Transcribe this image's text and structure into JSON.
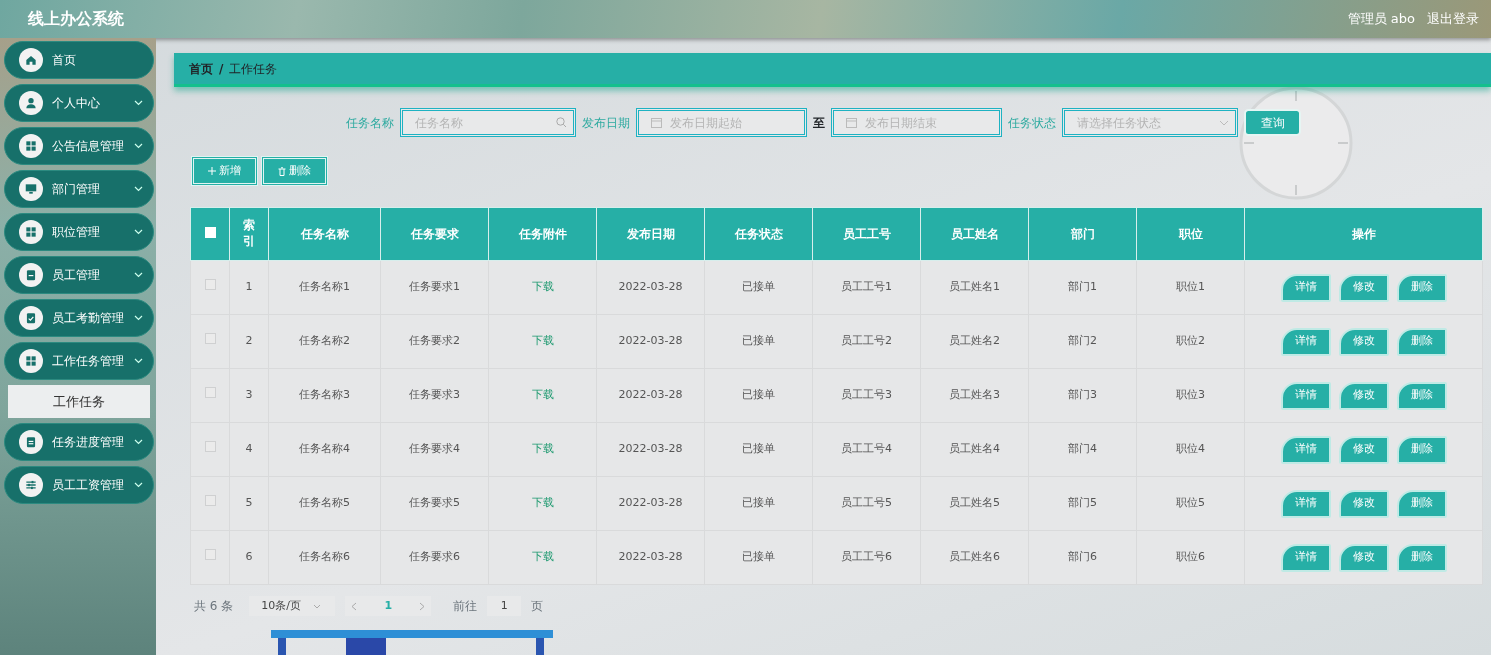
{
  "header": {
    "title": "线上办公系统",
    "role": "管理员",
    "username": "abo",
    "logout": "退出登录"
  },
  "sidebar": {
    "items": [
      {
        "label": "首页",
        "has_chevron": false
      },
      {
        "label": "个人中心",
        "has_chevron": true
      },
      {
        "label": "公告信息管理",
        "has_chevron": true
      },
      {
        "label": "部门管理",
        "has_chevron": true
      },
      {
        "label": "职位管理",
        "has_chevron": true
      },
      {
        "label": "员工管理",
        "has_chevron": true
      },
      {
        "label": "员工考勤管理",
        "has_chevron": true
      },
      {
        "label": "工作任务管理",
        "has_chevron": true,
        "children": [
          {
            "label": "工作任务",
            "selected": true
          }
        ]
      },
      {
        "label": "任务进度管理",
        "has_chevron": true
      },
      {
        "label": "员工工资管理",
        "has_chevron": true
      }
    ]
  },
  "breadcrumb": {
    "items": [
      "首页",
      "工作任务"
    ],
    "separator": "/"
  },
  "search": {
    "fields": [
      {
        "kind": "text",
        "label": "任务名称",
        "placeholder": "任务名称"
      },
      {
        "kind": "daterange",
        "label": "发布日期",
        "placeholder": "发布日期起始",
        "separator": "至",
        "placeholder_end": "发布日期结束"
      },
      {
        "kind": "select",
        "label": "任务状态",
        "placeholder": "请选择任务状态"
      }
    ],
    "button": "查询"
  },
  "actions": [
    {
      "kind": "add",
      "label": "新增"
    },
    {
      "kind": "delete",
      "label": "删除"
    }
  ],
  "table": {
    "select_all_checked": false,
    "columns": [
      "索引",
      "任务名称",
      "任务要求",
      "任务附件",
      "发布日期",
      "任务状态",
      "员工工号",
      "员工姓名",
      "部门",
      "职位",
      "操作"
    ],
    "rows": [
      {
        "checked": false,
        "cells": [
          "1",
          "任务名称1",
          "任务要求1",
          "下载",
          "2022-03-28",
          "已接单",
          "员工工号1",
          "员工姓名1",
          "部门1",
          "职位1"
        ],
        "buttons": [
          "详情",
          "修改",
          "删除"
        ]
      },
      {
        "checked": false,
        "cells": [
          "2",
          "任务名称2",
          "任务要求2",
          "下载",
          "2022-03-28",
          "已接单",
          "员工工号2",
          "员工姓名2",
          "部门2",
          "职位2"
        ],
        "buttons": [
          "详情",
          "修改",
          "删除"
        ]
      },
      {
        "checked": false,
        "cells": [
          "3",
          "任务名称3",
          "任务要求3",
          "下载",
          "2022-03-28",
          "已接单",
          "员工工号3",
          "员工姓名3",
          "部门3",
          "职位3"
        ],
        "buttons": [
          "详情",
          "修改",
          "删除"
        ]
      },
      {
        "checked": false,
        "cells": [
          "4",
          "任务名称4",
          "任务要求4",
          "下载",
          "2022-03-28",
          "已接单",
          "员工工号4",
          "员工姓名4",
          "部门4",
          "职位4"
        ],
        "buttons": [
          "详情",
          "修改",
          "删除"
        ]
      },
      {
        "checked": false,
        "cells": [
          "5",
          "任务名称5",
          "任务要求5",
          "下载",
          "2022-03-28",
          "已接单",
          "员工工号5",
          "员工姓名5",
          "部门5",
          "职位5"
        ],
        "buttons": [
          "详情",
          "修改",
          "删除"
        ]
      },
      {
        "checked": false,
        "cells": [
          "6",
          "任务名称6",
          "任务要求6",
          "下载",
          "2022-03-28",
          "已接单",
          "员工工号6",
          "员工姓名6",
          "部门6",
          "职位6"
        ],
        "buttons": [
          "详情",
          "修改",
          "删除"
        ]
      }
    ]
  },
  "pagination": {
    "total": "共 6 条",
    "page_size": "10条/页",
    "current": "1",
    "goto": "前往",
    "goto_value": "1",
    "goto_unit": "页"
  }
}
